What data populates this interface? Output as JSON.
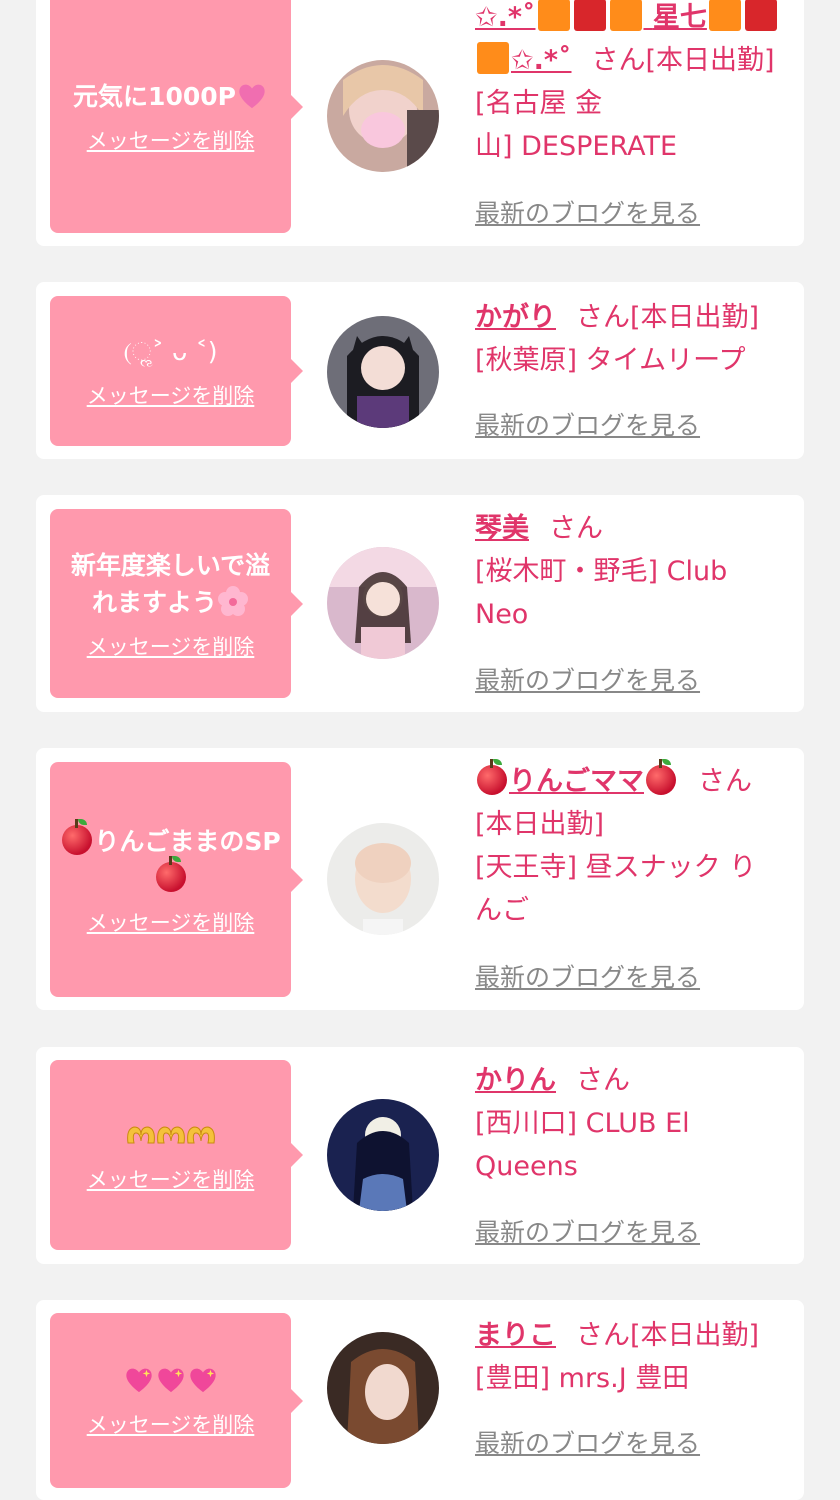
{
  "common": {
    "delete_label": "メッセージを削除",
    "blog_label": "最新のブログを見る",
    "san": "さん"
  },
  "colors": {
    "background": "#f2f2f2",
    "bubble": "#ff99ad",
    "accent": "#e0356a",
    "link_gray": "#888888"
  },
  "cards": [
    {
      "message": "元気に1000P",
      "message_icon": "pink-heart-icon",
      "name_parts": [
        "✩.*˚",
        "星七",
        "✩.*˚"
      ],
      "info_lines": [
        "[本日出勤]",
        "[名古屋 金",
        "山] DESPERATE"
      ]
    },
    {
      "message": "(ૢ˃ ᴗ ˂)",
      "name": "かがり",
      "info_lines": [
        "[本日出勤]",
        "[秋葉原] タイムリープ"
      ]
    },
    {
      "message": "新年度楽しいで溢れますよう",
      "message_icon": "cherry-blossom-icon",
      "name": "琴美",
      "info_lines": [
        "[桜木町・野毛] Club",
        "Neo"
      ]
    },
    {
      "message": "りんごままのSP",
      "message_icon": "apple-icon",
      "name": "りんごママ",
      "name_icon": "apple-icon",
      "info_lines": [
        "[本日出勤]",
        "[天王寺] 昼スナック り",
        "んご"
      ]
    },
    {
      "message_icon": "heart-hands-icon",
      "name": "かりん",
      "info_lines": [
        "[西川口] CLUB El",
        "Queens"
      ]
    },
    {
      "message_icon": "sparkling-heart-icon",
      "name": "まりこ",
      "info_lines": [
        "[本日出勤]",
        "[豊田] mrs.J 豊田"
      ]
    }
  ]
}
